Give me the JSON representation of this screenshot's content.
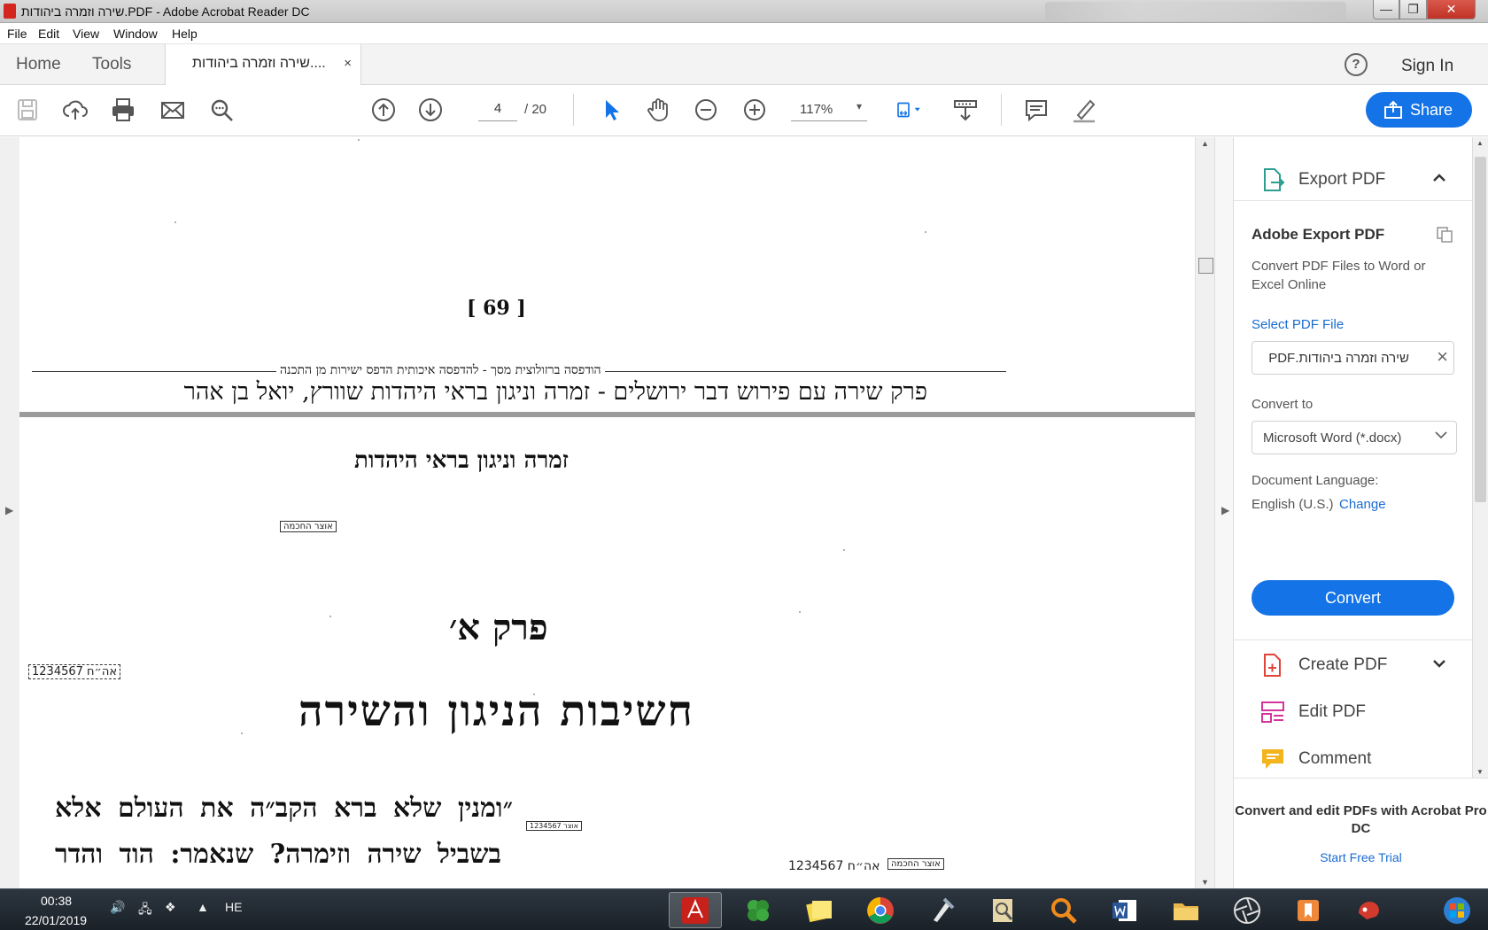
{
  "window": {
    "title": "שירה וזמרה ביהודות.PDF - Adobe Acrobat Reader DC",
    "controls": {
      "minimize": "—",
      "maximize": "❐",
      "close": "✕"
    }
  },
  "menu": [
    "File",
    "Edit",
    "View",
    "Window",
    "Help"
  ],
  "tabs": {
    "home": "Home",
    "tools": "Tools",
    "document": "שירה וזמרה ביהודות....",
    "close": "×",
    "sign_in": "Sign In",
    "help": "?"
  },
  "toolbar": {
    "current_page": "4",
    "total_pages": "/ 20",
    "zoom": "117%",
    "zoom_caret": "▾",
    "share": "Share",
    "icons": [
      "save-icon",
      "cloud-upload-icon",
      "print-icon",
      "email-icon",
      "search-icon",
      "prev-page-icon",
      "next-page-icon",
      "select-cursor-icon",
      "hand-icon",
      "zoom-out-icon",
      "zoom-in-icon",
      "fit-page-icon",
      "scroll-mode-icon",
      "comment-icon",
      "highlight-pen-icon"
    ],
    "accent": "#1473e6"
  },
  "document": {
    "page_number": "[ 69 ]",
    "print_note": "הודפסה ברזולוצית מסך - להדפסה איכותית הדפס ישירות מן התכנה",
    "header": "פרק שירה עם פירוש דבר ירושלים - זמרה וניגון בראי היהדות שוורץ, יואל בן אהר",
    "book_title": "זמרה וניגון בראי היהדות",
    "stamp_library": "אוצר החכמה",
    "chapter": "פרק א׳",
    "chapter_title": "חשיבות הניגון והשירה",
    "stamp_id": "אה״ח 1234567",
    "stamp_small": "אוצר 1234567",
    "body_line_1": "״ומנין שלא ברא הקב״ה את העולם אלא",
    "body_line_2": "בשביל שירה וזימרה? שנאמר: הוד והדר"
  },
  "right_pane": {
    "export_pdf": "Export PDF",
    "heading": "Adobe Export PDF",
    "description": "Convert PDF Files to Word or Excel Online",
    "select_file": "Select PDF File",
    "file_name": "שירה וזמרה ביהודות.PDF",
    "clear": "×",
    "convert_to": "Convert to",
    "format": "Microsoft Word (*.docx)",
    "doc_language_label": "Document Language:",
    "doc_language": "English (U.S.)",
    "change": "Change",
    "convert_button": "Convert",
    "create_pdf": "Create PDF",
    "edit_pdf": "Edit PDF",
    "comment": "Comment",
    "promo": "Convert and edit PDFs with Acrobat Pro DC",
    "trial": "Start Free Trial"
  },
  "taskbar": {
    "time": "00:38",
    "date": "22/01/2019",
    "language": "HE",
    "apps": [
      "acrobat-icon",
      "clover-icon",
      "sticky-notes-icon",
      "chrome-icon",
      "tool-icon",
      "scanner-icon",
      "search-app-icon",
      "word-icon",
      "explorer-icon",
      "aperture-icon",
      "bookmark-app-icon",
      "paint-icon",
      "windows-start-icon"
    ]
  }
}
